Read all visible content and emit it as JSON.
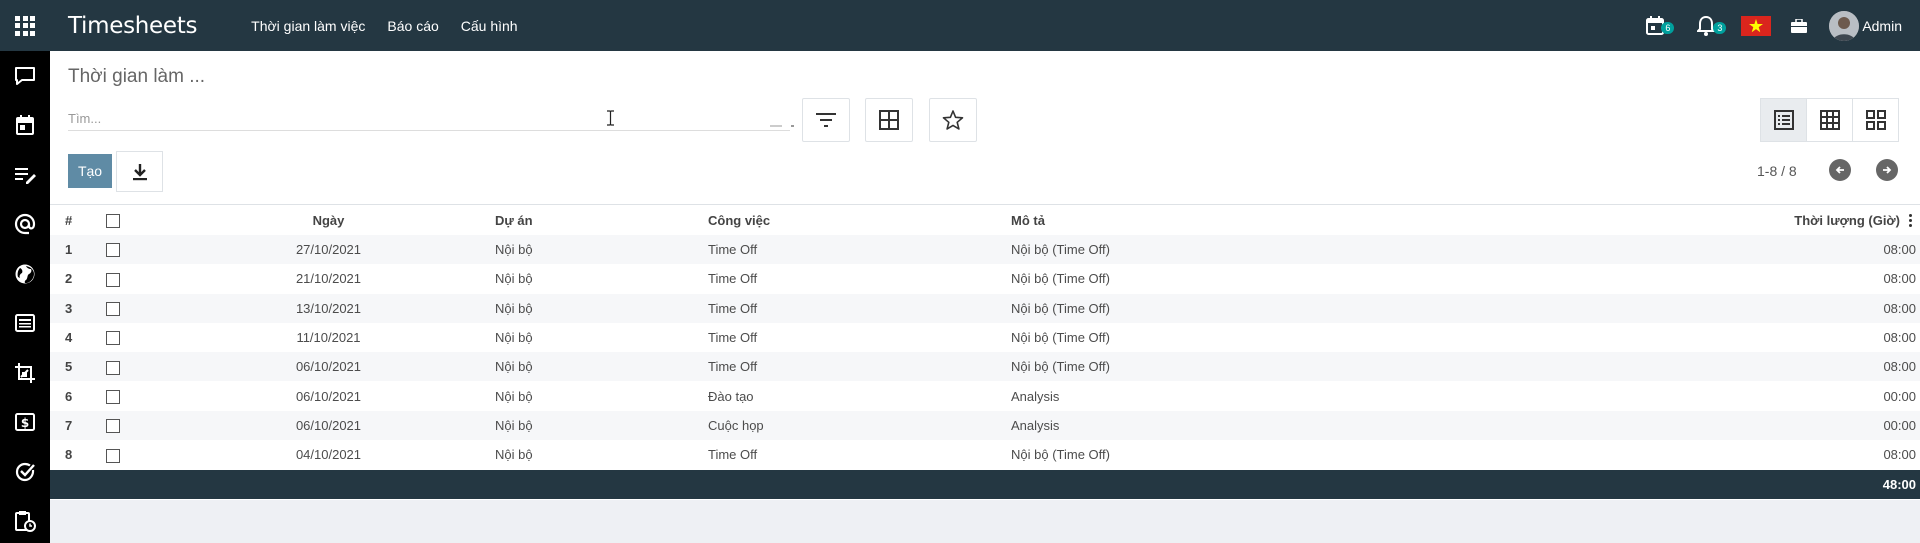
{
  "app": {
    "title": "Timesheets",
    "menu": [
      "Thời gian làm việc",
      "Báo cáo",
      "Cấu hình"
    ],
    "activity_count": "6",
    "notification_count": "3",
    "user_name": "Admin"
  },
  "sidebar_icons": [
    "chat-icon",
    "calendar-icon",
    "notes-icon",
    "at-sign-icon",
    "globe-icon",
    "newspaper-icon",
    "crop-tool-icon",
    "dollar-bill-icon",
    "check-circle-icon",
    "clipboard-clock-icon"
  ],
  "breadcrumb": "Thời gian làm ...",
  "search": {
    "placeholder": "Tìm..."
  },
  "buttons": {
    "create": "Tạo"
  },
  "pager": {
    "text": "1-8 / 8"
  },
  "table": {
    "headers": {
      "num": "#",
      "date": "Ngày",
      "project": "Dự án",
      "task": "Công việc",
      "description": "Mô tả",
      "duration": "Thời lượng (Giờ)"
    },
    "rows": [
      {
        "num": "1",
        "date": "27/10/2021",
        "project": "Nội bộ",
        "task": "Time Off",
        "description": "Nội bộ (Time Off)",
        "duration": "08:00"
      },
      {
        "num": "2",
        "date": "21/10/2021",
        "project": "Nội bộ",
        "task": "Time Off",
        "description": "Nội bộ (Time Off)",
        "duration": "08:00"
      },
      {
        "num": "3",
        "date": "13/10/2021",
        "project": "Nội bộ",
        "task": "Time Off",
        "description": "Nội bộ (Time Off)",
        "duration": "08:00"
      },
      {
        "num": "4",
        "date": "11/10/2021",
        "project": "Nội bộ",
        "task": "Time Off",
        "description": "Nội bộ (Time Off)",
        "duration": "08:00"
      },
      {
        "num": "5",
        "date": "06/10/2021",
        "project": "Nội bộ",
        "task": "Time Off",
        "description": "Nội bộ (Time Off)",
        "duration": "08:00"
      },
      {
        "num": "6",
        "date": "06/10/2021",
        "project": "Nội bộ",
        "task": "Đào tạo",
        "description": "Analysis",
        "duration": "00:00"
      },
      {
        "num": "7",
        "date": "06/10/2021",
        "project": "Nội bộ",
        "task": "Cuộc họp",
        "description": "Analysis",
        "duration": "00:00"
      },
      {
        "num": "8",
        "date": "04/10/2021",
        "project": "Nội bộ",
        "task": "Time Off",
        "description": "Nội bộ (Time Off)",
        "duration": "08:00"
      }
    ],
    "total": "48:00"
  },
  "colors": {
    "navbar": "#243742",
    "primary_button": "#5f8ba5",
    "badge": "#00a09d",
    "sidebar": "#000000"
  }
}
